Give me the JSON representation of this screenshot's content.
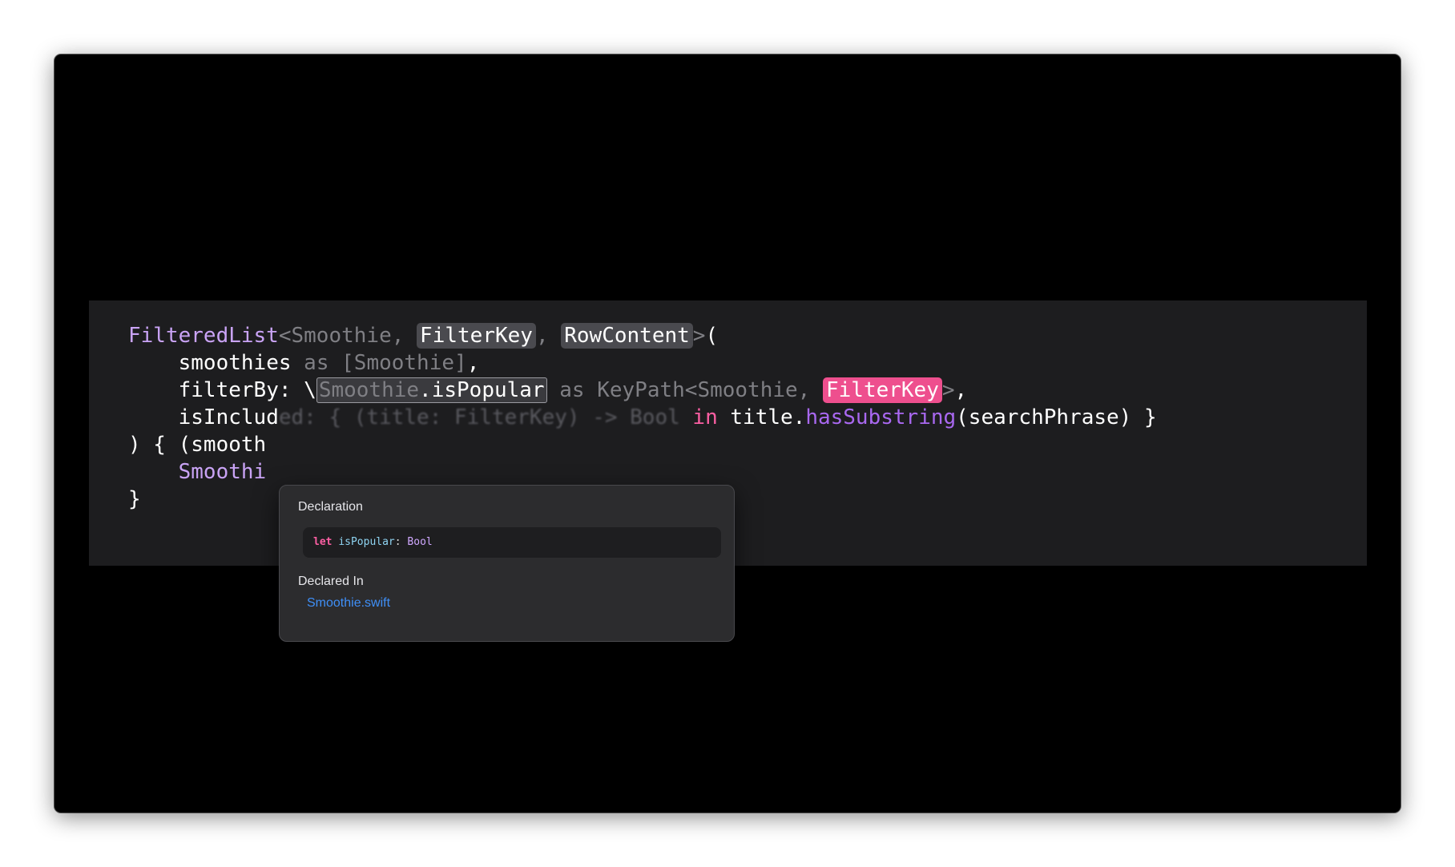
{
  "code": {
    "line1": {
      "type_name": "FilteredList",
      "open_angle": "<",
      "generic_smoothie": "Smoothie",
      "comma1": ", ",
      "filter_key": "FilterKey",
      "comma2": ", ",
      "row_content": "RowContent",
      "close_angle": ">",
      "open_paren": "("
    },
    "line2": {
      "indent": "    ",
      "label": "smoothies",
      "as_kw": " as ",
      "type": "[Smoothie]",
      "comma": ","
    },
    "line3": {
      "indent": "    ",
      "label": "filterBy: \\",
      "keypath_root": "Smoothie",
      "keypath_prop": ".isPopular",
      "as_kw": " as ",
      "keypath_type": "KeyPath<Smoothie, ",
      "filter_key": "FilterKey",
      "close": ">",
      "comma": ","
    },
    "line4": {
      "indent": "    ",
      "label": "isInclud",
      "hidden": "ed: { (title: FilterKey) -> Bool ",
      "in_kw": "in",
      "space": " ",
      "title_obj": "title.",
      "method": "hasSubstring",
      "args": "(searchPhrase) }"
    },
    "line5": {
      "text": ") { ",
      "param": "(smooth"
    },
    "line6": {
      "indent": "    ",
      "text": "Smoothi"
    },
    "line7": {
      "text": "}"
    }
  },
  "popover": {
    "declaration_heading": "Declaration",
    "decl_let": "let",
    "decl_name": "isPopular",
    "decl_colon": ": ",
    "decl_type": "Bool",
    "declared_in_heading": "Declared In",
    "file_name": "Smoothie.swift"
  },
  "colors": {
    "background": "#000000",
    "editor_background": "#1d1d1f",
    "keyword_pink": "#fc5fa3",
    "type_purple": "#c9a3f5",
    "method_violet": "#a968f0",
    "link_blue": "#3f8ff7"
  }
}
